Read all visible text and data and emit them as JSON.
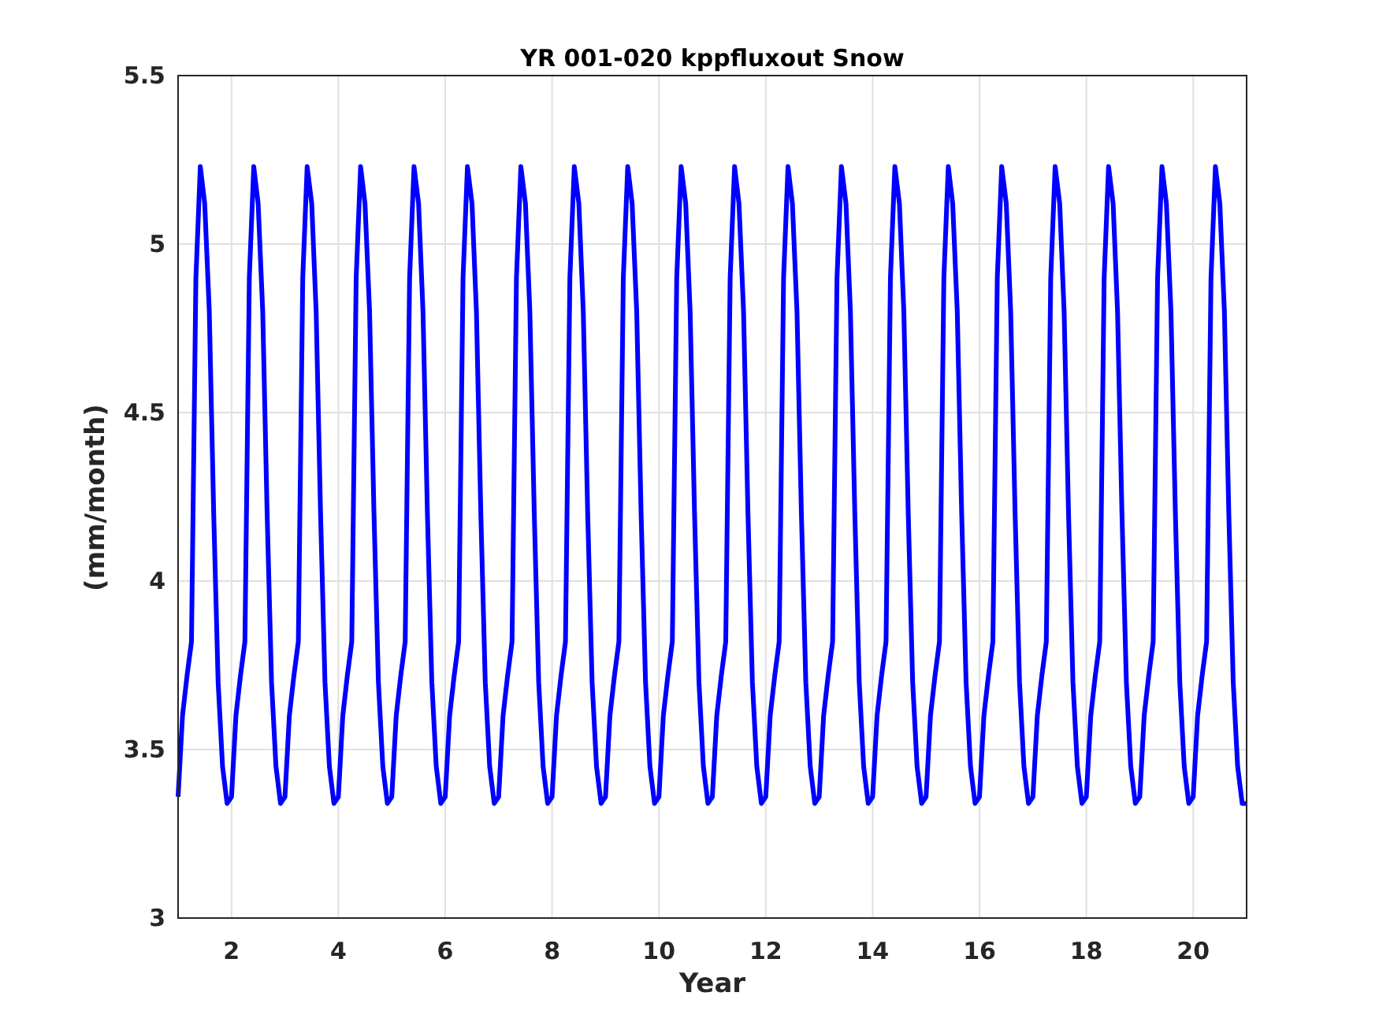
{
  "figure": {
    "chart_data": {
      "type": "line",
      "title": "YR 001-020 kppfluxout Snow",
      "xlabel": "Year",
      "ylabel": "(mm/month)",
      "xlim": [
        1,
        21
      ],
      "ylim": [
        3,
        5.5
      ],
      "xticks": [
        2,
        4,
        6,
        8,
        10,
        12,
        14,
        16,
        18,
        20
      ],
      "yticks": [
        3,
        3.5,
        4,
        4.5,
        5,
        5.5
      ],
      "grid": true,
      "x": [
        1,
        1.0833,
        1.1667,
        1.25,
        1.3333,
        1.4167,
        1.5,
        1.5833,
        1.6667,
        1.75,
        1.8333,
        1.9167,
        2,
        2.0833,
        2.1667,
        2.25,
        2.3333,
        2.4167,
        2.5,
        2.5833,
        2.6667,
        2.75,
        2.8333,
        2.9167,
        3,
        3.0833,
        3.1667,
        3.25,
        3.3333,
        3.4167,
        3.5,
        3.5833,
        3.6667,
        3.75,
        3.8333,
        3.9167,
        4,
        4.0833,
        4.1667,
        4.25,
        4.3333,
        4.4167,
        4.5,
        4.5833,
        4.6667,
        4.75,
        4.8333,
        4.9167,
        5,
        5.0833,
        5.1667,
        5.25,
        5.3333,
        5.4167,
        5.5,
        5.5833,
        5.6667,
        5.75,
        5.8333,
        5.9167,
        6,
        6.0833,
        6.1667,
        6.25,
        6.3333,
        6.4167,
        6.5,
        6.5833,
        6.6667,
        6.75,
        6.8333,
        6.9167,
        7,
        7.0833,
        7.1667,
        7.25,
        7.3333,
        7.4167,
        7.5,
        7.5833,
        7.6667,
        7.75,
        7.8333,
        7.9167,
        8,
        8.0833,
        8.1667,
        8.25,
        8.3333,
        8.4167,
        8.5,
        8.5833,
        8.6667,
        8.75,
        8.8333,
        8.9167,
        9,
        9.0833,
        9.1667,
        9.25,
        9.3333,
        9.4167,
        9.5,
        9.5833,
        9.6667,
        9.75,
        9.8333,
        9.9167,
        10,
        10.0833,
        10.1667,
        10.25,
        10.3333,
        10.4167,
        10.5,
        10.5833,
        10.6667,
        10.75,
        10.8333,
        10.9167,
        11,
        11.0833,
        11.1667,
        11.25,
        11.3333,
        11.4167,
        11.5,
        11.5833,
        11.6667,
        11.75,
        11.8333,
        11.9167,
        12,
        12.0833,
        12.1667,
        12.25,
        12.3333,
        12.4167,
        12.5,
        12.5833,
        12.6667,
        12.75,
        12.8333,
        12.9167,
        13,
        13.0833,
        13.1667,
        13.25,
        13.3333,
        13.4167,
        13.5,
        13.5833,
        13.6667,
        13.75,
        13.8333,
        13.9167,
        14,
        14.0833,
        14.1667,
        14.25,
        14.3333,
        14.4167,
        14.5,
        14.5833,
        14.6667,
        14.75,
        14.8333,
        14.9167,
        15,
        15.0833,
        15.1667,
        15.25,
        15.3333,
        15.4167,
        15.5,
        15.5833,
        15.6667,
        15.75,
        15.8333,
        15.9167,
        16,
        16.0833,
        16.1667,
        16.25,
        16.3333,
        16.4167,
        16.5,
        16.5833,
        16.6667,
        16.75,
        16.8333,
        16.9167,
        17,
        17.0833,
        17.1667,
        17.25,
        17.3333,
        17.4167,
        17.5,
        17.5833,
        17.6667,
        17.75,
        17.8333,
        17.9167,
        18,
        18.0833,
        18.1667,
        18.25,
        18.3333,
        18.4167,
        18.5,
        18.5833,
        18.6667,
        18.75,
        18.8333,
        18.9167,
        19,
        19.0833,
        19.1667,
        19.25,
        19.3333,
        19.4167,
        19.5,
        19.5833,
        19.6667,
        19.75,
        19.8333,
        19.9167,
        20,
        20.0833,
        20.1667,
        20.25,
        20.3333,
        20.4167,
        20.5,
        20.5833,
        20.6667,
        20.75,
        20.8333,
        20.9167,
        21
      ],
      "series": [
        {
          "color": "#0000ff",
          "values": [
            3.36,
            3.6,
            3.72,
            3.82,
            4.9,
            5.23,
            5.12,
            4.8,
            4.2,
            3.7,
            3.45,
            3.34,
            3.36,
            3.6,
            3.72,
            3.82,
            4.9,
            5.23,
            5.12,
            4.8,
            4.2,
            3.7,
            3.45,
            3.34,
            3.36,
            3.6,
            3.72,
            3.82,
            4.9,
            5.23,
            5.12,
            4.8,
            4.2,
            3.7,
            3.45,
            3.34,
            3.36,
            3.6,
            3.72,
            3.82,
            4.9,
            5.23,
            5.12,
            4.8,
            4.2,
            3.7,
            3.45,
            3.34,
            3.36,
            3.6,
            3.72,
            3.82,
            4.9,
            5.23,
            5.12,
            4.8,
            4.2,
            3.7,
            3.45,
            3.34,
            3.36,
            3.6,
            3.72,
            3.82,
            4.9,
            5.23,
            5.12,
            4.8,
            4.2,
            3.7,
            3.45,
            3.34,
            3.36,
            3.6,
            3.72,
            3.82,
            4.9,
            5.23,
            5.12,
            4.8,
            4.2,
            3.7,
            3.45,
            3.34,
            3.36,
            3.6,
            3.72,
            3.82,
            4.9,
            5.23,
            5.12,
            4.8,
            4.2,
            3.7,
            3.45,
            3.34,
            3.36,
            3.6,
            3.72,
            3.82,
            4.9,
            5.23,
            5.12,
            4.8,
            4.2,
            3.7,
            3.45,
            3.34,
            3.36,
            3.6,
            3.72,
            3.82,
            4.9,
            5.23,
            5.12,
            4.8,
            4.2,
            3.7,
            3.45,
            3.34,
            3.36,
            3.6,
            3.72,
            3.82,
            4.9,
            5.23,
            5.12,
            4.8,
            4.2,
            3.7,
            3.45,
            3.34,
            3.36,
            3.6,
            3.72,
            3.82,
            4.9,
            5.23,
            5.12,
            4.8,
            4.2,
            3.7,
            3.45,
            3.34,
            3.36,
            3.6,
            3.72,
            3.82,
            4.9,
            5.23,
            5.12,
            4.8,
            4.2,
            3.7,
            3.45,
            3.34,
            3.36,
            3.6,
            3.72,
            3.82,
            4.9,
            5.23,
            5.12,
            4.8,
            4.2,
            3.7,
            3.45,
            3.34,
            3.36,
            3.6,
            3.72,
            3.82,
            4.9,
            5.23,
            5.12,
            4.8,
            4.2,
            3.7,
            3.45,
            3.34,
            3.36,
            3.6,
            3.72,
            3.82,
            4.9,
            5.23,
            5.12,
            4.8,
            4.2,
            3.7,
            3.45,
            3.34,
            3.36,
            3.6,
            3.72,
            3.82,
            4.9,
            5.23,
            5.12,
            4.8,
            4.2,
            3.7,
            3.45,
            3.34,
            3.36,
            3.6,
            3.72,
            3.82,
            4.9,
            5.23,
            5.12,
            4.8,
            4.2,
            3.7,
            3.45,
            3.34,
            3.36,
            3.6,
            3.72,
            3.82,
            4.9,
            5.23,
            5.12,
            4.8,
            4.2,
            3.7,
            3.45,
            3.34,
            3.36,
            3.6,
            3.72,
            3.82,
            4.9,
            5.23,
            5.12,
            4.8,
            4.2,
            3.7,
            3.45,
            3.34,
            3.34
          ]
        }
      ]
    }
  }
}
